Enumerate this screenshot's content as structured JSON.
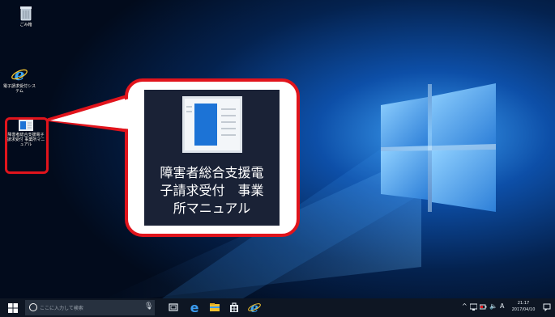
{
  "desktop": {
    "icons": [
      {
        "label": "ごみ箱"
      },
      {
        "label": "電子請求受付システム"
      },
      {
        "label": "障害者総合支援電子請求受付 事業所マニュアル"
      }
    ]
  },
  "callout": {
    "lines": [
      "障害者総合支援電",
      "子請求受付　事業",
      "所マニュアル"
    ]
  },
  "taskbar": {
    "search_placeholder": "ここに入力して検索",
    "tray_ime": "A",
    "clock_time": "21:17",
    "clock_date": "2017/04/10"
  },
  "colors": {
    "highlight": "#e1141c",
    "wallpaper_accent": "#2f8fe0",
    "taskbar_bg": "#0e1623"
  }
}
